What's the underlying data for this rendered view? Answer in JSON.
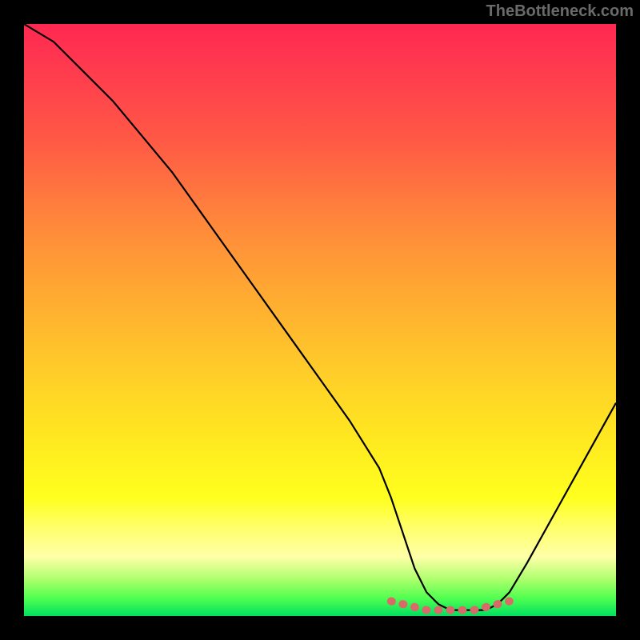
{
  "watermark": "TheBottleneck.com",
  "chart_data": {
    "type": "line",
    "title": "",
    "xlabel": "",
    "ylabel": "",
    "xlim": [
      0,
      100
    ],
    "ylim": [
      0,
      100
    ],
    "series": [
      {
        "name": "bottleneck-curve",
        "x": [
          0,
          5,
          10,
          15,
          20,
          25,
          30,
          35,
          40,
          45,
          50,
          55,
          60,
          62,
          64,
          66,
          68,
          70,
          72,
          74,
          76,
          78,
          80,
          82,
          85,
          90,
          95,
          100
        ],
        "y": [
          100,
          97,
          92,
          87,
          81,
          75,
          68,
          61,
          54,
          47,
          40,
          33,
          25,
          20,
          14,
          8,
          4,
          2,
          1,
          1,
          1,
          1,
          2,
          4,
          9,
          18,
          27,
          36
        ]
      },
      {
        "name": "optimal-range-markers",
        "x": [
          62,
          64,
          66,
          68,
          70,
          72,
          74,
          76,
          78,
          80,
          82
        ],
        "y": [
          2.5,
          2,
          1.5,
          1,
          1,
          1,
          1,
          1,
          1.5,
          2,
          2.5
        ]
      }
    ],
    "background_gradient": {
      "stops": [
        {
          "pos": 0.0,
          "color": "#ff2850"
        },
        {
          "pos": 0.2,
          "color": "#ff5a45"
        },
        {
          "pos": 0.48,
          "color": "#ffb030"
        },
        {
          "pos": 0.7,
          "color": "#ffe820"
        },
        {
          "pos": 0.85,
          "color": "#ffff6a"
        },
        {
          "pos": 0.94,
          "color": "#a8ff6a"
        },
        {
          "pos": 1.0,
          "color": "#00e060"
        }
      ]
    }
  }
}
